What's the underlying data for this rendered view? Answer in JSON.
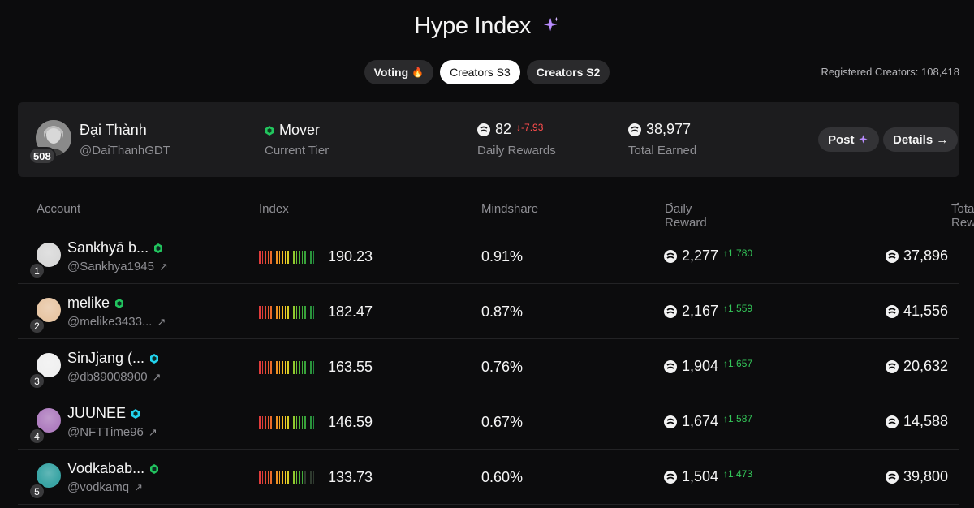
{
  "header": {
    "title": "Hype Index"
  },
  "tabs": [
    {
      "label": "Voting",
      "icon": "fire-icon"
    },
    {
      "label": "Creators S3",
      "active": true
    },
    {
      "label": "Creators S2"
    }
  ],
  "registered": "Registered Creators: 108,418",
  "profile": {
    "rank": "508",
    "name": "Đại Thành",
    "handle": "@DaiThanhGDT",
    "tier": "Mover",
    "tier_label": "Current Tier",
    "daily_rewards": "82",
    "daily_delta": "↓-7.93",
    "daily_label": "Daily Rewards",
    "total_earned": "38,977",
    "total_label": "Total Earned",
    "post_label": "Post",
    "details_label": "Details →"
  },
  "table": {
    "headers": {
      "account": "Account",
      "index": "Index",
      "mindshare": "Mindshare",
      "daily": "Daily Reward",
      "total": "Total Reward"
    },
    "rows": [
      {
        "rank": "1",
        "name": "Sankhyā b...",
        "handle": "@Sankhya1945",
        "badge_color": "#22c55e",
        "index": "190.23",
        "index_level": 1.0,
        "mindshare": "0.91%",
        "daily": "2,277",
        "daily_delta": "↑1,780",
        "total": "37,896",
        "avatar": "#d9d9d9"
      },
      {
        "rank": "2",
        "name": "melike",
        "handle": "@melike3433...",
        "badge_color": "#22c55e",
        "index": "182.47",
        "index_level": 1.0,
        "mindshare": "0.87%",
        "daily": "2,167",
        "daily_delta": "↑1,559",
        "total": "41,556",
        "avatar": "#e8c7a6"
      },
      {
        "rank": "3",
        "name": "SinJjang (...",
        "handle": "@db89008900",
        "badge_color": "#22d3ee",
        "index": "163.55",
        "index_level": 1.0,
        "mindshare": "0.76%",
        "daily": "1,904",
        "daily_delta": "↑1,657",
        "total": "20,632",
        "avatar": "#f0f0f0"
      },
      {
        "rank": "4",
        "name": "JUUNEE",
        "handle": "@NFTTime96",
        "badge_color": "#22d3ee",
        "index": "146.59",
        "index_level": 1.0,
        "mindshare": "0.67%",
        "daily": "1,674",
        "daily_delta": "↑1,587",
        "total": "14,588",
        "avatar": "#b07fc0"
      },
      {
        "rank": "5",
        "name": "Vodkabab...",
        "handle": "@vodkamq",
        "badge_color": "#22c55e",
        "index": "133.73",
        "index_level": 0.78,
        "mindshare": "0.60%",
        "daily": "1,504",
        "daily_delta": "↑1,473",
        "total": "39,800",
        "avatar": "#3aa5a5"
      }
    ]
  },
  "colors": {
    "accent_purple": "#b98cff",
    "down": "#ff4d4d",
    "up": "#34c759"
  }
}
